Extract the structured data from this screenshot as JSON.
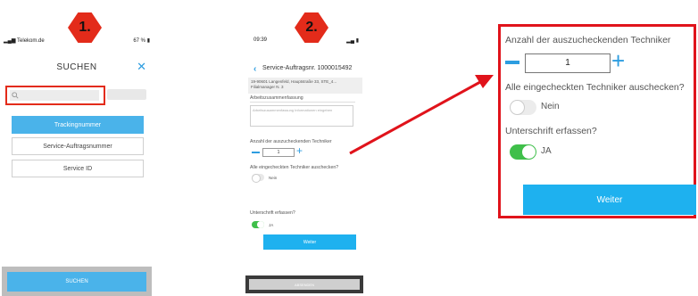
{
  "badges": {
    "step1": "1.",
    "step2": "2."
  },
  "phone1": {
    "status_carrier": "Telekom.de",
    "status_battery": "67 %",
    "title": "SUCHEN",
    "buttons": [
      "Trackingnummer",
      "Service-Auftragsnummer",
      "Service ID"
    ],
    "bottom_button": "SUCHEN"
  },
  "phone2": {
    "status_time": "09:39",
    "title": "Service-Auftragsnr. 1000015492",
    "address_line1": "19-90601 Langenfeld, Hauptstraße 33, STE_4...",
    "address_line2": "Filialmanager N. 3",
    "summary_label": "Arbeitszusammenfassung",
    "summary_placeholder": "Arbeitszusammenfassung Informationen eingeben",
    "technicians_label": "Anzahl der auszucheckenden Techniker",
    "quantity": "1",
    "checkout_all_label": "Alle eingecheckten Techniker auschecken?",
    "checkout_all_value": "Nein",
    "signature_label": "Unterschrift erfassen?",
    "signature_value": "JA",
    "weiter_label": "Weiter",
    "bottom_button": "ABSENDEN"
  },
  "zoom": {
    "technicians_label": "Anzahl der auszucheckenden Techniker",
    "quantity": "1",
    "checkout_all_label": "Alle eingecheckten Techniker auschecken?",
    "checkout_all_value": "Nein",
    "signature_label": "Unterschrift erfassen?",
    "signature_value": "JA",
    "weiter_label": "Weiter"
  },
  "colors": {
    "accent": "#2d9de0",
    "button": "#1eb1ef",
    "highlight": "#e0131b",
    "toggle_on": "#3fbf4a"
  },
  "icons": {
    "close": "close-icon",
    "search": "search-icon",
    "back": "chevron-left-icon"
  }
}
